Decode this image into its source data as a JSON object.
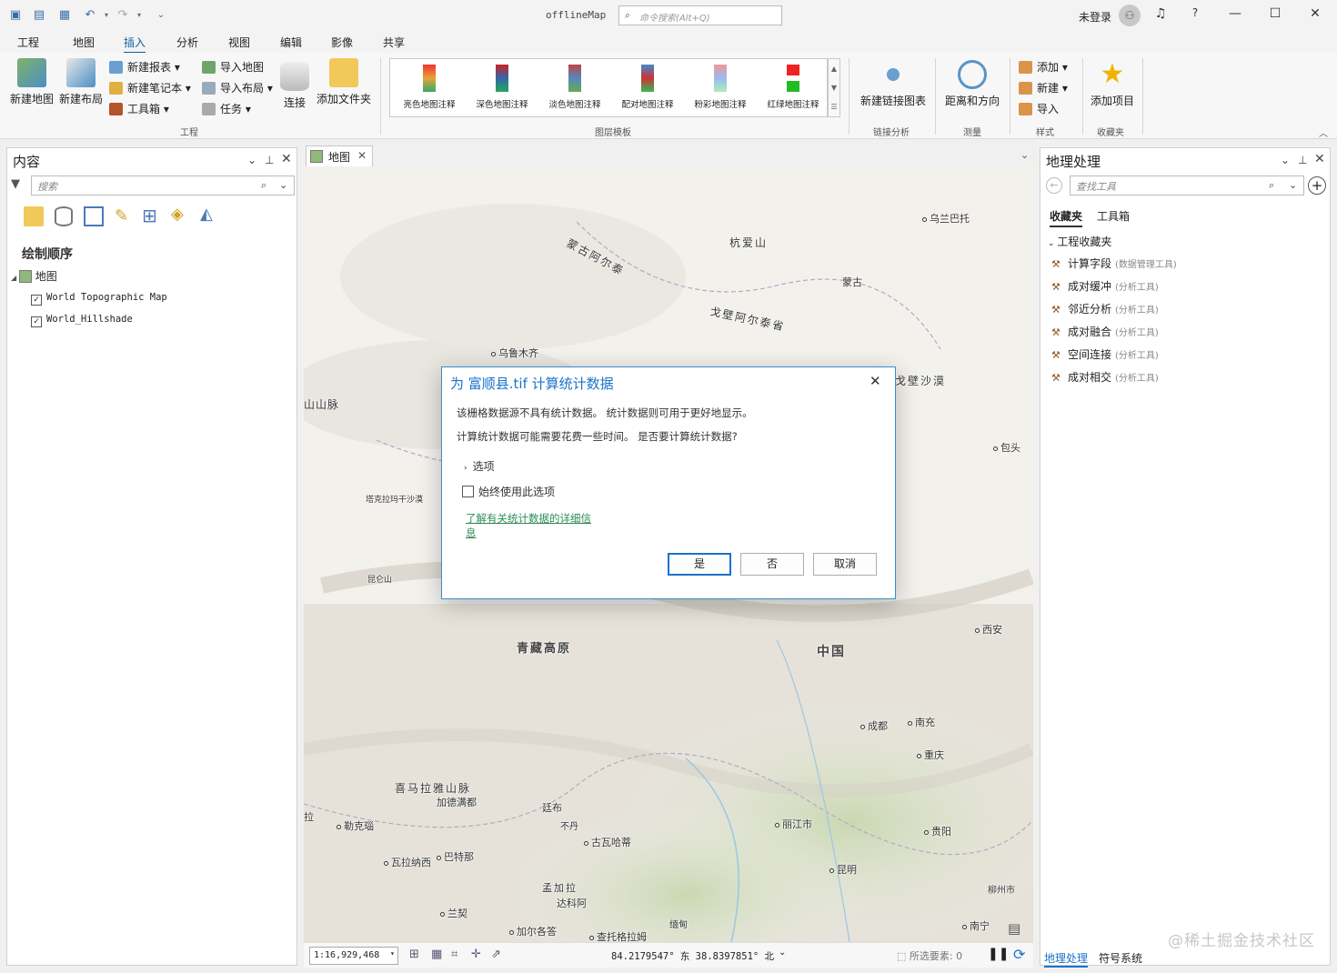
{
  "app": {
    "title": "offlineMap",
    "search_placeholder": "命令搜索(Alt+Q)",
    "login": "未登录"
  },
  "menu": [
    "工程",
    "地图",
    "插入",
    "分析",
    "视图",
    "编辑",
    "影像",
    "共享"
  ],
  "ribbon": {
    "project": {
      "new_map": "新建地图",
      "new_layout": "新建布局",
      "new_report": "新建报表",
      "new_notebook": "新建笔记本",
      "toolbox": "工具箱",
      "import_map": "导入地图",
      "import_layout": "导入布局",
      "task": "任务",
      "connect": "连接",
      "add_folder": "添加文件夹",
      "group": "工程"
    },
    "templates": {
      "items": [
        "亮色地图注释",
        "深色地图注释",
        "淡色地图注释",
        "配对地图注释",
        "粉彩地图注释",
        "红绿地图注释"
      ],
      "group": "图层模板"
    },
    "link": {
      "new_link_chart": "新建链接图表",
      "group": "链接分析"
    },
    "measure": {
      "distance": "距离和方向",
      "group": "测量"
    },
    "styles": {
      "add": "添加",
      "new": "新建",
      "import": "导入",
      "group": "样式"
    },
    "favorites": {
      "add_item": "添加项目",
      "group": "收藏夹"
    }
  },
  "contents": {
    "title": "内容",
    "search": "搜索",
    "draw_order": "绘制顺序",
    "map": "地图",
    "layers": [
      "World Topographic Map",
      "World_Hillshade"
    ]
  },
  "map_tab": "地图",
  "map_labels": [
    "乌兰巴托",
    "杭爱山",
    "蒙古阿尔泰",
    "蒙古",
    "戈壁阿尔泰省",
    "乌鲁木齐",
    "戈壁沙漠",
    "包头",
    "山山脉",
    "塔克拉玛干沙漠",
    "昆仑山",
    "西安",
    "青藏高原",
    "中国",
    "成都",
    "南充",
    "重庆",
    "喜马拉雅山脉",
    "加德满都",
    "廷布",
    "勒克瑙",
    "不丹",
    "丽江市",
    "贵阳",
    "古瓦哈蒂",
    "瓦拉纳西",
    "巴特那",
    "昆明",
    "孟加拉",
    "达科阿",
    "柳州市",
    "兰契",
    "加尔各答",
    "缅甸",
    "南宁",
    "查托格拉姆",
    "拉"
  ],
  "status": {
    "scale": "1:16,929,468",
    "coords": "84.2179547° 东 38.8397851° 北",
    "selected": "所选要素: 0"
  },
  "dialog": {
    "title": "为 富顺县.tif 计算统计数据",
    "line1": "该栅格数据源不具有统计数据。 统计数据则可用于更好地显示。",
    "line2": "计算统计数据可能需要花费一些时间。 是否要计算统计数据?",
    "options": "选项",
    "always": "始终使用此选项",
    "link1": "了解有关统计数据的详细信",
    "link2": "息",
    "yes": "是",
    "no": "否",
    "cancel": "取消"
  },
  "geoproc": {
    "title": "地理处理",
    "search": "查找工具",
    "tabs": [
      "收藏夹",
      "工具箱"
    ],
    "folder": "工程收藏夹",
    "tools": [
      {
        "name": "计算字段",
        "cat": "(数据管理工具)"
      },
      {
        "name": "成对缓冲",
        "cat": "(分析工具)"
      },
      {
        "name": "邻近分析",
        "cat": "(分析工具)"
      },
      {
        "name": "成对融合",
        "cat": "(分析工具)"
      },
      {
        "name": "空间连接",
        "cat": "(分析工具)"
      },
      {
        "name": "成对相交",
        "cat": "(分析工具)"
      }
    ],
    "bottom_tabs": [
      "地理处理",
      "符号系统"
    ]
  },
  "watermark": "@稀土掘金技术社区"
}
